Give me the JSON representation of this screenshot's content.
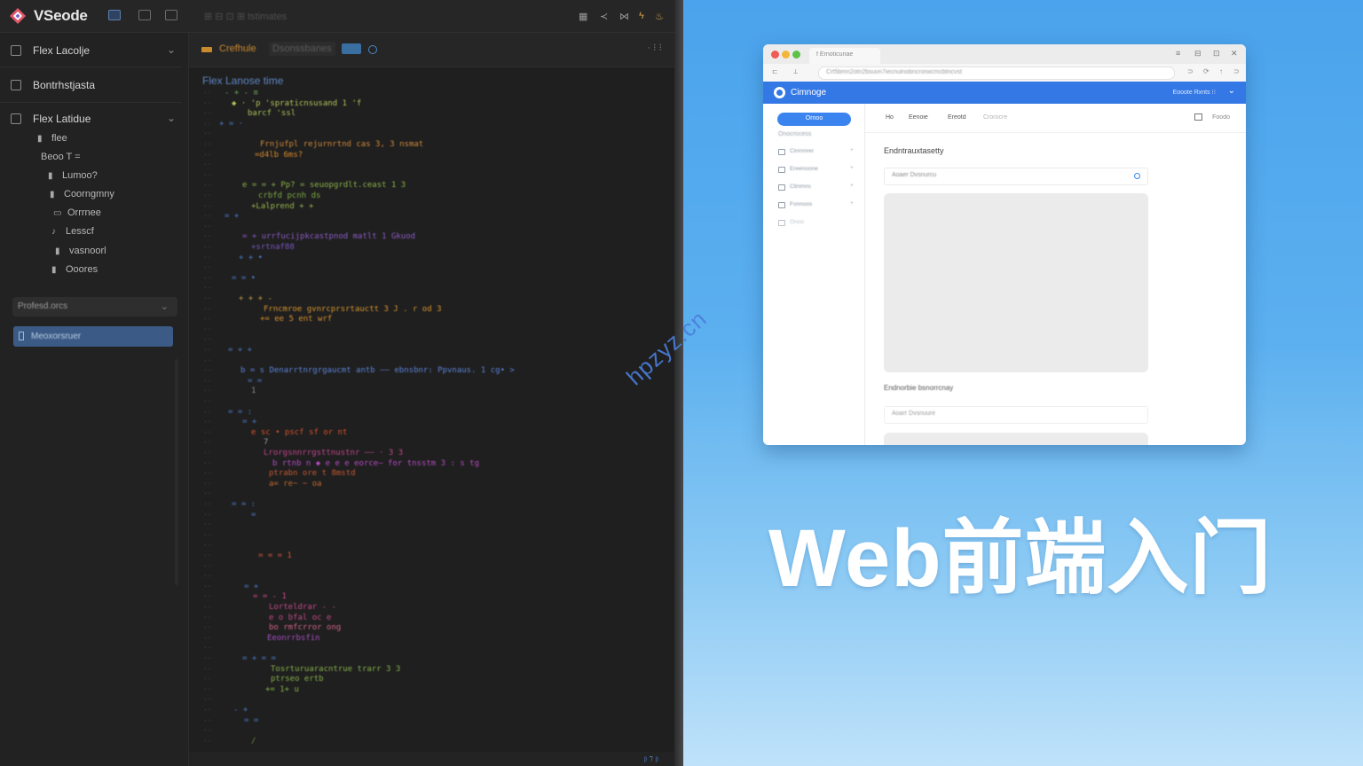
{
  "editor": {
    "app_title": "VSeode",
    "titlebar_blur": "⊞ ⊟ ⊡ ⊞ tstimates",
    "sidebar": {
      "sections": [
        {
          "label": "Flex Lacolje",
          "chevron": "⌄"
        },
        {
          "label": "Bontrhstjasta",
          "chevron": ""
        },
        {
          "label": "Flex Latidue",
          "chevron": "⌄"
        }
      ],
      "tree": [
        {
          "glyph": "▮",
          "label": "flee"
        },
        {
          "glyph": "",
          "label": "Beoo T ="
        },
        {
          "glyph": "▮",
          "label": "Lumoo?"
        },
        {
          "glyph": "▮",
          "label": "Coorngmny"
        },
        {
          "glyph": "▭",
          "label": "Orrrnee"
        },
        {
          "glyph": "♪",
          "label": "Lesscf"
        },
        {
          "glyph": "▮",
          "label": "vasnoorl"
        },
        {
          "glyph": "▮",
          "label": "Ooores"
        }
      ],
      "field_label": "Profesd.orcs",
      "active_item": "Meoxorsruer"
    },
    "tabs": [
      {
        "label": "Crefhule",
        "color": "#c98a2e"
      },
      {
        "label": "Dsonssbanes",
        "color": "#5a5a5a"
      }
    ],
    "tab_more": "· ⁝ ⁝",
    "breadcrumb": "Flex Lanose time",
    "status": "ᵦ ⁊ ᵦ"
  },
  "code_lines": [
    {
      "indent": 40,
      "text": "- + -   ≡",
      "color": "#6aa35a"
    },
    {
      "indent": 48,
      "text": "◆ ·  'p 'spraticnsusand  1 'f",
      "color": "#b7c35a"
    },
    {
      "indent": 66,
      "text": "barcf 'ssl",
      "color": "#a9c45a"
    },
    {
      "indent": 34,
      "text": "+ = ·",
      "color": "#4d7bc9"
    },
    {
      "indent": 74,
      "text": "",
      "color": "#4d7bc9"
    },
    {
      "indent": 80,
      "text": "Frnjufpl rejurnrtnd cas 3, 3 nsmat",
      "color": "#d28a3a"
    },
    {
      "indent": 74,
      "text": "=d4lb 6ms?",
      "color": "#d88a2f"
    },
    {
      "indent": 34,
      "text": "",
      "color": "#3c3c3c"
    },
    {
      "indent": 42,
      "text": "",
      "color": "#3c3c3c"
    },
    {
      "indent": 60,
      "text": "e = = +  Pp?  = seuopgrdlt.ceast 1 3",
      "color": "#8bb24a"
    },
    {
      "indent": 78,
      "text": "crbfd pcnh ds",
      "color": "#7faa45"
    },
    {
      "indent": 70,
      "text": "+Lalprend   +  +",
      "color": "#98b84d"
    },
    {
      "indent": 40,
      "text": "= +",
      "color": "#4d7bc9"
    },
    {
      "indent": 54,
      "text": "",
      "color": "#3c3c3c"
    },
    {
      "indent": 60,
      "text": "= + urrfucijpkcastpnod matlt   1  Gkuod",
      "color": "#8c5bc6"
    },
    {
      "indent": 70,
      "text": "+srtnaf88",
      "color": "#7a56c3"
    },
    {
      "indent": 56,
      "text": "+ + •",
      "color": "#4d7bc9"
    },
    {
      "indent": 34,
      "text": "",
      "color": "#3c3c3c"
    },
    {
      "indent": 48,
      "text": "= = •",
      "color": "#4d7bc9"
    },
    {
      "indent": 64,
      "text": "",
      "color": "#3c3c3c"
    },
    {
      "indent": 56,
      "text": "+ + + -",
      "color": "#c3a24a"
    },
    {
      "indent": 84,
      "text": "Frncmroe gvnrcprsrtauctt 3  J . r od 3",
      "color": "#d6952e"
    },
    {
      "indent": 80,
      "text": "+= ee 5 ent wrf",
      "color": "#d49031"
    },
    {
      "indent": 34,
      "text": "",
      "color": "#3c3c3c"
    },
    {
      "indent": 40,
      "text": "",
      "color": "#3c3c3c"
    },
    {
      "indent": 44,
      "text": "= + +",
      "color": "#4d7bc9"
    },
    {
      "indent": 60,
      "text": "",
      "color": "#3c3c3c"
    },
    {
      "indent": 58,
      "text": "b = s Denarrtnrgrgaucmt antb    —— ebnsbnr: Ppvnaus.    1 cg•  >",
      "color": "#5c84d8"
    },
    {
      "indent": 66,
      "text": "= =",
      "color": "#4d7bc9"
    },
    {
      "indent": 70,
      "text": "1",
      "color": "#8a8a8a"
    },
    {
      "indent": 34,
      "text": "",
      "color": "#3c3c3c"
    },
    {
      "indent": 44,
      "text": "= = :",
      "color": "#4d7bc9"
    },
    {
      "indent": 60,
      "text": "= +",
      "color": "#4d7bc9"
    },
    {
      "indent": 70,
      "text": "e sc  • pscf  sf  or nt",
      "color": "#d2542c"
    },
    {
      "indent": 84,
      "text": "7",
      "color": "#999"
    },
    {
      "indent": 84,
      "text": "Lrorgsnnrrgsttnustnr  —— ·  3  3",
      "color": "#c2468e"
    },
    {
      "indent": 94,
      "text": "b rtnb n ◆ e e e eorce— for tnsstm 3 : s tg",
      "color": "#b64bc5"
    },
    {
      "indent": 90,
      "text": "ptrabn ore t 8mstd",
      "color": "#c35a33"
    },
    {
      "indent": 90,
      "text": "a= re~ ~  oa",
      "color": "#c06a33"
    },
    {
      "indent": 40,
      "text": "",
      "color": "#3c3c3c"
    },
    {
      "indent": 48,
      "text": "= = :",
      "color": "#4d7bc9"
    },
    {
      "indent": 70,
      "text": "=",
      "color": "#4d7bc9"
    },
    {
      "indent": 70,
      "text": "",
      "color": "#3c3c3c"
    },
    {
      "indent": 74,
      "text": "",
      "color": "#3c3c3c"
    },
    {
      "indent": 74,
      "text": "",
      "color": "#3c3c3c"
    },
    {
      "indent": 78,
      "text": "= = =  1",
      "color": "#d4593a"
    },
    {
      "indent": 34,
      "text": "",
      "color": "#3c3c3c"
    },
    {
      "indent": 60,
      "text": "",
      "color": "#3c3c3c"
    },
    {
      "indent": 62,
      "text": "= +",
      "color": "#4d7bc9"
    },
    {
      "indent": 72,
      "text": "= = - 1",
      "color": "#c94a8f"
    },
    {
      "indent": 90,
      "text": "Lorteldrar  -  -",
      "color": "#c64a8a"
    },
    {
      "indent": 90,
      "text": "e o bfal oc e",
      "color": "#c64a8a"
    },
    {
      "indent": 90,
      "text": "bo rmfcrror ong",
      "color": "#d0628a"
    },
    {
      "indent": 88,
      "text": "Eeonrrbsfin",
      "color": "#a64fc0"
    },
    {
      "indent": 34,
      "text": "",
      "color": "#3c3c3c"
    },
    {
      "indent": 60,
      "text": "= + = =",
      "color": "#4d7bc9"
    },
    {
      "indent": 92,
      "text": "Tosrturuaracntrue trarr 3 3",
      "color": "#86b24a"
    },
    {
      "indent": 92,
      "text": "ptrseo  ertb",
      "color": "#86b24a"
    },
    {
      "indent": 86,
      "text": "+= 1+ u",
      "color": "#86b24a"
    },
    {
      "indent": 34,
      "text": "",
      "color": "#3c3c3c"
    },
    {
      "indent": 50,
      "text": "- +",
      "color": "#4d7bc9"
    },
    {
      "indent": 62,
      "text": "= =",
      "color": "#4d7bc9"
    },
    {
      "indent": 40,
      "text": "",
      "color": "#3c3c3c"
    },
    {
      "indent": 70,
      "text": "/",
      "color": "#6c8a42"
    },
    {
      "indent": 56,
      "text": "/",
      "color": "#6c8a42"
    },
    {
      "indent": 34,
      "text": "",
      "color": "#3c3c3c"
    },
    {
      "indent": 40,
      "text": "-",
      "color": "#6c8a42"
    }
  ],
  "browser": {
    "tab_title": "f  Ernoticunae",
    "address": "Crt5bmn2otn2bsuvn7iecnulnobncrorwcmcbtncvst",
    "window_controls": [
      "≡",
      "⊟",
      "⊡",
      "✕"
    ],
    "nav_left": [
      "⊏",
      "⟂"
    ],
    "nav_right": [
      "⊃",
      "⟳",
      "↑",
      "⊃"
    ],
    "header": {
      "title": "Cimnoge",
      "right": "Eooote   Rxnts  ⁝⁝",
      "chevron": "⌄"
    },
    "sidebar": {
      "button": "Ornoo",
      "subtitle": "Onocrocess",
      "items": [
        {
          "label": "Cinrnnrer",
          "caret": "+"
        },
        {
          "label": "Ereenoone",
          "caret": "+"
        },
        {
          "label": "Ctinmns",
          "caret": "+"
        },
        {
          "label": "Fonnoos",
          "caret": "+"
        },
        {
          "label": "Onoo",
          "caret": ""
        }
      ]
    },
    "topnav": [
      "Ho",
      "Eenoie",
      "Ereotd",
      "Crorocre"
    ],
    "topnav_right": "Foodo",
    "heading": "Endntrauxtasetty",
    "input1": "Aoaer   Dvsnurcu",
    "heading2": "Endnorbie bsnorrcnay",
    "input2": "Aoarr   Dvsnuure"
  },
  "headline": "Web前端入门",
  "watermark": "hpzyz.cn",
  "colors": {
    "editor_bg": "#1f1f1f",
    "accent_blue": "#3478e5",
    "sky_top": "#4aa3ec",
    "sky_bottom": "#bfe2fa",
    "headline": "#ffffff",
    "watermark": "#4b7fdc"
  }
}
